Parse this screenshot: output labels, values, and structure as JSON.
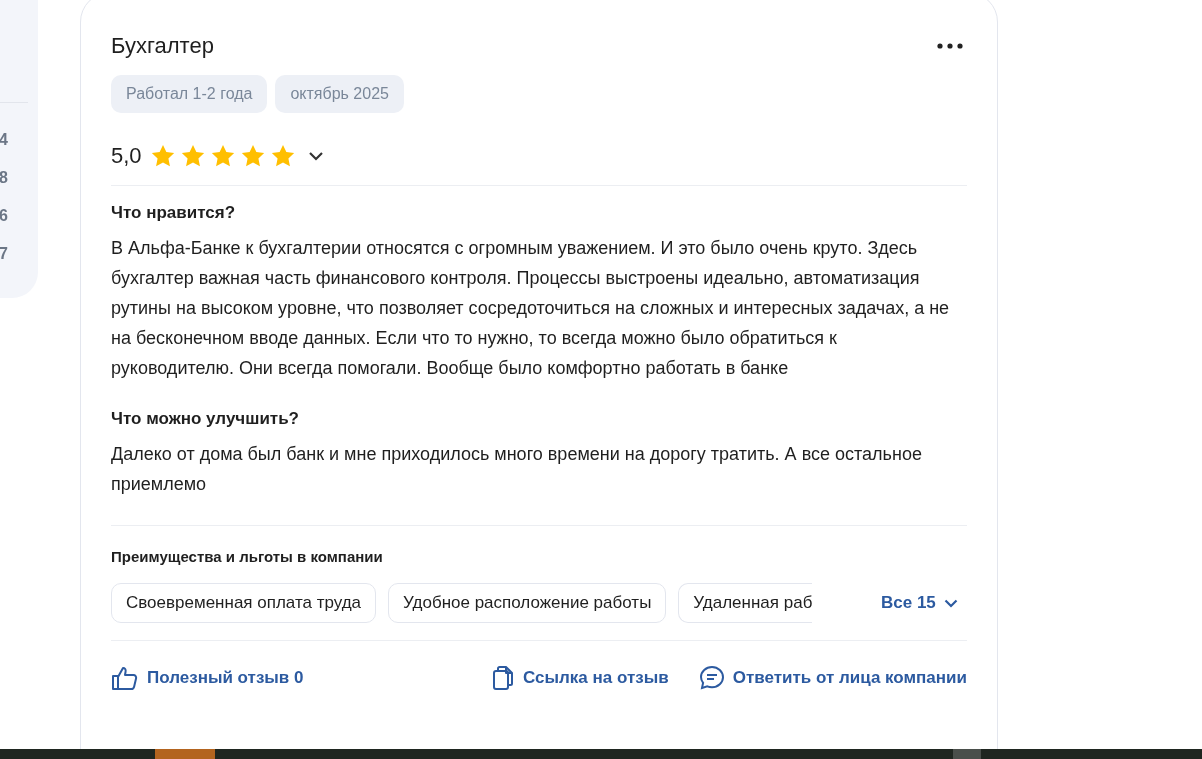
{
  "sidebar": {
    "counts": [
      "4",
      "8",
      "6",
      "7"
    ]
  },
  "review": {
    "title": "Бухгалтер",
    "tags": [
      "Работал 1-2 года",
      "октябрь 2025"
    ],
    "rating": {
      "score": "5,0",
      "stars": 5
    },
    "sections": [
      {
        "heading": "Что нравится?",
        "text": "В Альфа-Банке к бухгалтерии относятся с огромным уважением. И это было очень круто. Здесь бухгалтер важная часть финансового контроля. Процессы выстроены идеально, автоматизация рутины на высоком уровне, что позволяет сосредоточиться на сложных и интересных задачах, а не на бесконечном вводе данных. Если что то нужно, то всегда можно было обратиться к руководителю. Они всегда помогали. Вообще было комфортно работать в банке"
      },
      {
        "heading": "Что можно улучшить?",
        "text": "Далеко от дома был банк и мне приходилось много времени на дорогу тратить. А все остальное приемлемо"
      }
    ],
    "benefits": {
      "heading": "Преимущества и льготы в компании",
      "items": [
        "Своевременная оплата труда",
        "Удобное расположение работы",
        "Удаленная раб"
      ],
      "more": "Все 15"
    },
    "actions": [
      {
        "kind": "like",
        "label": "Полезный отзыв 0"
      },
      {
        "kind": "link",
        "label": "Ссылка на отзыв"
      },
      {
        "kind": "reply",
        "label": "Ответить от лица компании"
      }
    ]
  }
}
